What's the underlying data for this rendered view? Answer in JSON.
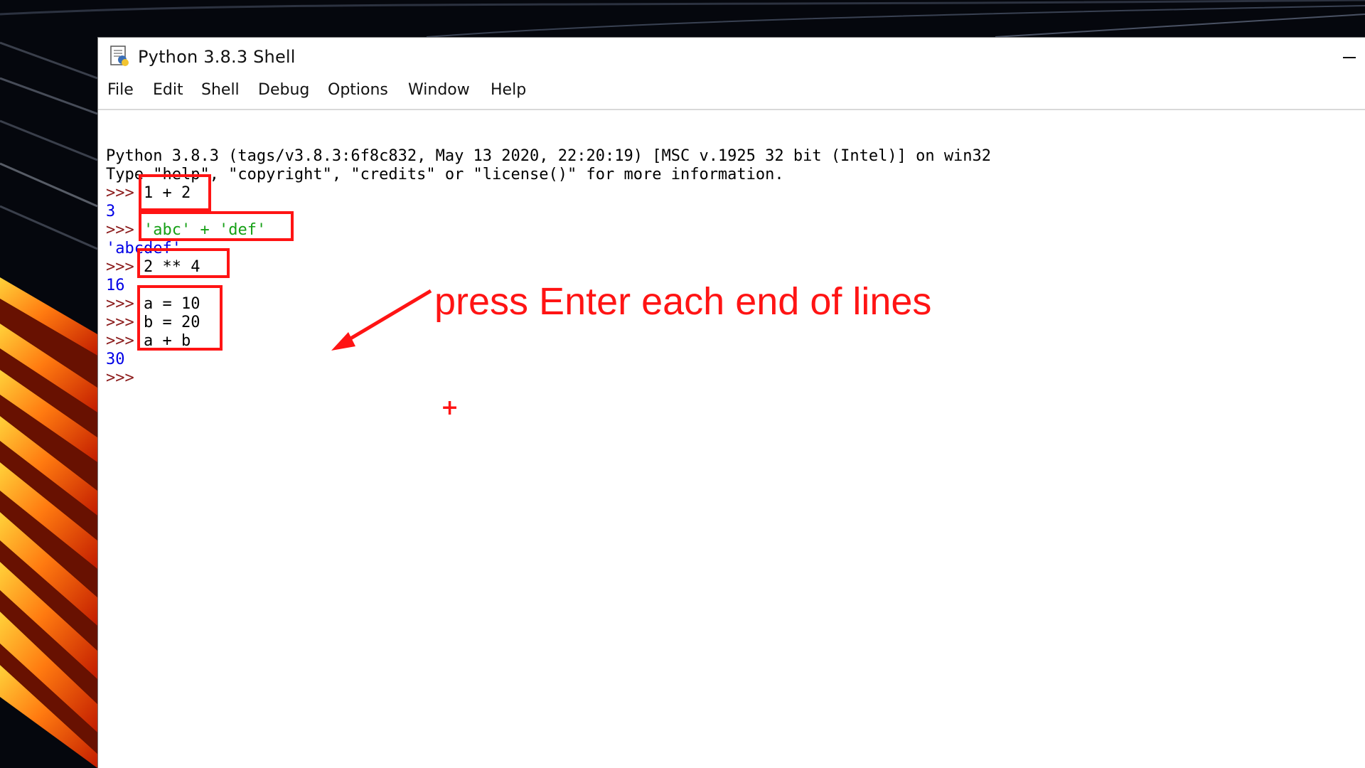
{
  "window": {
    "title": "Python 3.8.3 Shell",
    "app_icon": "python-idle-icon",
    "minimize_icon": "minimize-icon"
  },
  "menu": [
    "File",
    "Edit",
    "Shell",
    "Debug",
    "Options",
    "Window",
    "Help"
  ],
  "shell": {
    "banner1": "Python 3.8.3 (tags/v3.8.3:6f8c832, May 13 2020, 22:20:19) [MSC v.1925 32 bit (Intel)] on win32",
    "banner2": "Type \"help\", \"copyright\", \"credits\" or \"license()\" for more information.",
    "prompt": ">>>",
    "entries": [
      {
        "input": "1 + 2",
        "output": "3"
      },
      {
        "input": "'abc' + 'def'",
        "output": "'abcdef'"
      },
      {
        "input": "2 ** 4",
        "output": "16"
      },
      {
        "input": "a = 10"
      },
      {
        "input": "b = 20"
      },
      {
        "input": "a + b",
        "output": "30"
      }
    ]
  },
  "annotation": {
    "text": "press Enter each end of lines",
    "color": "#ff1414",
    "cursor": "+"
  },
  "colors": {
    "prompt": "#8b1a1a",
    "output": "#0000e6",
    "string": "#16a016",
    "annotation": "#ff1414"
  }
}
